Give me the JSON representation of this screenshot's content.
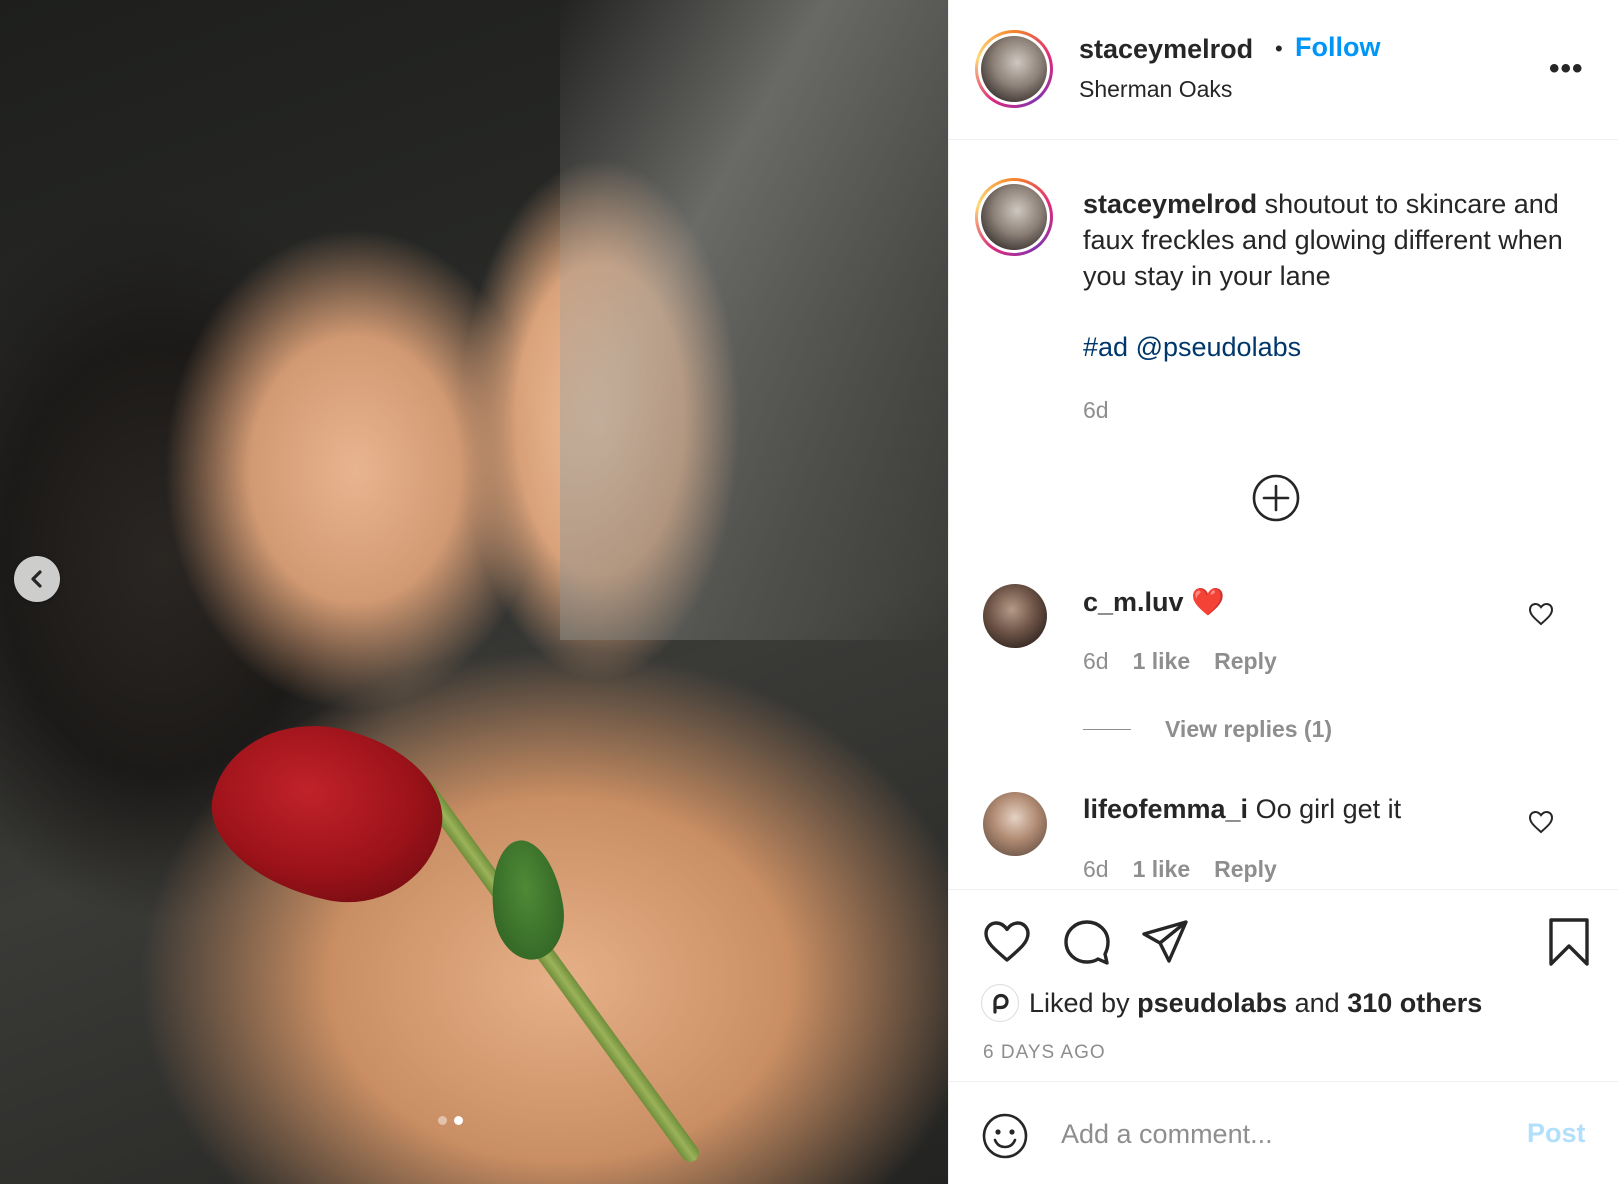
{
  "post": {
    "image_alt": "",
    "carousel": {
      "total": 2,
      "active": 2
    }
  },
  "header": {
    "username": "staceymelrod",
    "bullet": "•",
    "follow_label": "Follow",
    "location": "Sherman Oaks",
    "more_label": "•••"
  },
  "caption": {
    "username": "staceymelrod",
    "text": " shoutout to skincare and faux freckles and glowing different when you stay in your lane",
    "hashtag": "#ad",
    "mention": "@pseudolabs",
    "time": "6d"
  },
  "comments": [
    {
      "username": "c_m.luv",
      "text": " ❤️",
      "time": "6d",
      "likes": "1 like",
      "reply_label": "Reply",
      "view_replies": "View replies (1)"
    },
    {
      "username": "lifeofemma_i",
      "text": " Oo girl get it",
      "time": "6d",
      "likes": "1 like",
      "reply_label": "Reply"
    }
  ],
  "actions": {
    "liked_by_prefix": "Liked by ",
    "liked_by_user": "pseudolabs",
    "liked_by_mid": " and ",
    "liked_by_others": "310 others",
    "timestamp": "6 DAYS AGO"
  },
  "composer": {
    "placeholder": "Add a comment...",
    "post_label": "Post"
  },
  "colors": {
    "link_blue": "#0095f6",
    "hashtag_blue": "#00376b",
    "muted": "#8e8e8e",
    "post_disabled": "#b2dffc"
  }
}
